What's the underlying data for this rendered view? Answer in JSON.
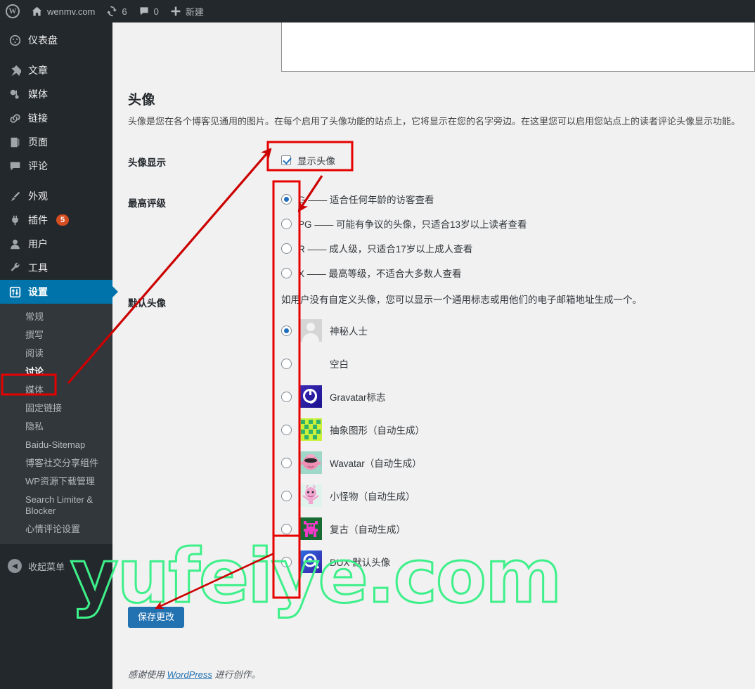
{
  "adminbar": {
    "site_name": "wenmv.com",
    "updates_count": "6",
    "comments_count": "0",
    "new_label": "新建",
    "icons": {
      "wp_logo": "wordpress-logo-icon",
      "home": "home-icon",
      "updates": "refresh-icon",
      "comments": "comment-bubble-icon",
      "new": "plus-icon"
    }
  },
  "sidebar": {
    "items": [
      {
        "label": "仪表盘",
        "icon": "dashboard-icon",
        "badge": ""
      },
      {
        "label": "文章",
        "icon": "pin-icon",
        "badge": ""
      },
      {
        "label": "媒体",
        "icon": "media-icon",
        "badge": ""
      },
      {
        "label": "链接",
        "icon": "link-icon",
        "badge": ""
      },
      {
        "label": "页面",
        "icon": "page-icon",
        "badge": ""
      },
      {
        "label": "评论",
        "icon": "comment-icon",
        "badge": ""
      },
      {
        "label": "外观",
        "icon": "brush-icon",
        "badge": ""
      },
      {
        "label": "插件",
        "icon": "plug-icon",
        "badge": "5"
      },
      {
        "label": "用户",
        "icon": "user-icon",
        "badge": ""
      },
      {
        "label": "工具",
        "icon": "wrench-icon",
        "badge": ""
      },
      {
        "label": "设置",
        "icon": "settings-icon",
        "badge": ""
      }
    ],
    "submenu": [
      "常规",
      "撰写",
      "阅读",
      "讨论",
      "媒体",
      "固定链接",
      "隐私",
      "Baidu-Sitemap",
      "博客社交分享组件",
      "WP资源下载管理",
      "Search Limiter & Blocker",
      "心情评论设置"
    ],
    "active_submenu": "讨论",
    "collapse_label": "收起菜单"
  },
  "main": {
    "section_title": "头像",
    "section_desc": "头像是您在各个博客见通用的图片。在每个启用了头像功能的站点上，它将显示在您的名字旁边。在这里您可以启用您站点上的读者评论头像显示功能。",
    "avatar_display": {
      "label": "头像显示",
      "checkbox_label": "显示头像",
      "checked": true
    },
    "max_rating": {
      "label": "最高评级",
      "selected": "G",
      "options": [
        {
          "value": "G",
          "text": "G —— 适合任何年龄的访客查看"
        },
        {
          "value": "PG",
          "text": "PG —— 可能有争议的头像，只适合13岁以上读者查看"
        },
        {
          "value": "R",
          "text": "R —— 成人级，只适合17岁以上成人查看"
        },
        {
          "value": "X",
          "text": "X —— 最高等级，不适合大多数人查看"
        }
      ]
    },
    "default_avatar": {
      "label": "默认头像",
      "desc": "如用户没有自定义头像，您可以显示一个通用标志或用他们的电子邮箱地址生成一个。",
      "selected": "mystery",
      "options": [
        {
          "value": "mystery",
          "text": "神秘人士",
          "icon": "mystery-person-avatar-icon"
        },
        {
          "value": "blank",
          "text": "空白",
          "icon": "blank-avatar-icon"
        },
        {
          "value": "gravatar",
          "text": "Gravatar标志",
          "icon": "gravatar-logo-icon"
        },
        {
          "value": "identicon",
          "text": "抽象图形（自动生成）",
          "icon": "identicon-avatar-icon"
        },
        {
          "value": "wavatar",
          "text": "Wavatar（自动生成）",
          "icon": "wavatar-avatar-icon"
        },
        {
          "value": "monster",
          "text": "小怪物（自动生成）",
          "icon": "monsterid-avatar-icon"
        },
        {
          "value": "retro",
          "text": "复古（自动生成）",
          "icon": "retro-avatar-icon"
        },
        {
          "value": "dux",
          "text": "DUX 默认头像",
          "icon": "dux-default-avatar-icon"
        }
      ]
    },
    "save_button": "保存更改",
    "footer_prefix": "感谢使用 ",
    "footer_link": "WordPress",
    "footer_suffix": " 进行创作。"
  },
  "watermark": {
    "text": "yufeiye.com",
    "color": "#3ef08a"
  },
  "annotations": {
    "accent_color": "#e60000",
    "boxes": [
      "discussion-menu-highlight",
      "show-avatars-checkbox-highlight",
      "radio-column-highlight",
      "dux-avatar-radio-highlight"
    ],
    "arrows": [
      "discussion-to-show-avatars-arrow",
      "radio-column-to-g-option-arrow",
      "dux-avatar-to-save-button-arrow"
    ]
  }
}
